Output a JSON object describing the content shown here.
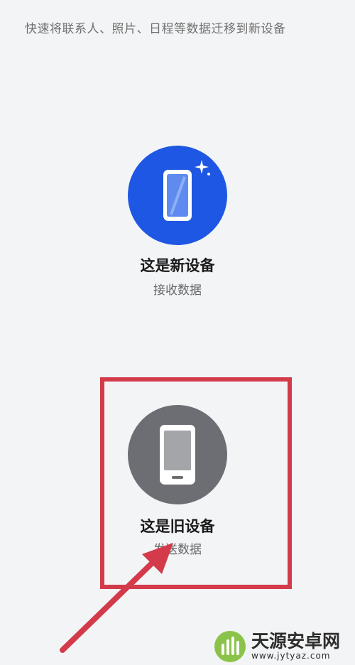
{
  "header": {
    "subtitle": "快速将联系人、照片、日程等数据迁移到新设备"
  },
  "new_device": {
    "title": "这是新设备",
    "subtitle": "接收数据",
    "icon": "new-phone-icon",
    "color": "#1d57e3"
  },
  "old_device": {
    "title": "这是旧设备",
    "subtitle": "发送数据",
    "icon": "old-phone-icon",
    "color": "#6c6e73"
  },
  "annotation": {
    "color": "#d33a4a"
  },
  "watermark": {
    "title": "天源安卓网",
    "url": "www.jytyaz.com"
  }
}
